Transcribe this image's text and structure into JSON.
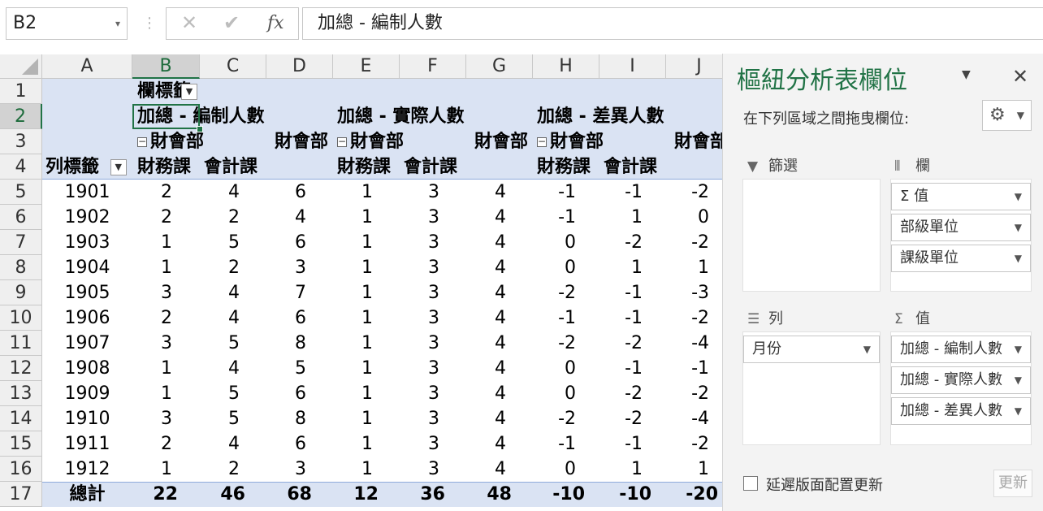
{
  "formula_bar": {
    "name_box": "B2",
    "cancel_icon": "✕",
    "enter_icon": "✔",
    "fx_label": "fx",
    "content": "加總 - 編制人數"
  },
  "columns": [
    "A",
    "B",
    "C",
    "D",
    "E",
    "F",
    "G",
    "H",
    "I",
    "J"
  ],
  "rows": [
    "1",
    "2",
    "3",
    "4",
    "5",
    "6",
    "7",
    "8",
    "9",
    "10",
    "11",
    "12",
    "13",
    "14",
    "15",
    "16",
    "17"
  ],
  "pivot": {
    "col_labels": "欄標籤",
    "row_labels": "列標籤",
    "value_headers": [
      "加總 - 編制人數",
      "加總 - 實際人數",
      "加總 - 差異人數"
    ],
    "dept": "財會部",
    "sections": [
      "財務課",
      "會計課"
    ],
    "dept_total": "財會部",
    "data": [
      [
        "1901",
        "2",
        "4",
        "6",
        "1",
        "3",
        "4",
        "-1",
        "-1",
        "-2"
      ],
      [
        "1902",
        "2",
        "2",
        "4",
        "1",
        "3",
        "4",
        "-1",
        "1",
        "0"
      ],
      [
        "1903",
        "1",
        "5",
        "6",
        "1",
        "3",
        "4",
        "0",
        "-2",
        "-2"
      ],
      [
        "1904",
        "1",
        "2",
        "3",
        "1",
        "3",
        "4",
        "0",
        "1",
        "1"
      ],
      [
        "1905",
        "3",
        "4",
        "7",
        "1",
        "3",
        "4",
        "-2",
        "-1",
        "-3"
      ],
      [
        "1906",
        "2",
        "4",
        "6",
        "1",
        "3",
        "4",
        "-1",
        "-1",
        "-2"
      ],
      [
        "1907",
        "3",
        "5",
        "8",
        "1",
        "3",
        "4",
        "-2",
        "-2",
        "-4"
      ],
      [
        "1908",
        "1",
        "4",
        "5",
        "1",
        "3",
        "4",
        "0",
        "-1",
        "-1"
      ],
      [
        "1909",
        "1",
        "5",
        "6",
        "1",
        "3",
        "4",
        "0",
        "-2",
        "-2"
      ],
      [
        "1910",
        "3",
        "5",
        "8",
        "1",
        "3",
        "4",
        "-2",
        "-2",
        "-4"
      ],
      [
        "1911",
        "2",
        "4",
        "6",
        "1",
        "3",
        "4",
        "-1",
        "-1",
        "-2"
      ],
      [
        "1912",
        "1",
        "2",
        "3",
        "1",
        "3",
        "4",
        "0",
        "1",
        "1"
      ]
    ],
    "total": [
      "總計",
      "22",
      "46",
      "68",
      "12",
      "36",
      "48",
      "-10",
      "-10",
      "-20"
    ]
  },
  "pane": {
    "title": "樞紐分析表欄位",
    "subtitle": "在下列區域之間拖曳欄位:",
    "filters_label": "篩選",
    "columns_label": "欄",
    "rows_label": "列",
    "values_label": "值",
    "column_fields": [
      "Σ 值",
      "部級單位",
      "課級單位"
    ],
    "row_fields": [
      "月份"
    ],
    "value_fields": [
      "加總 - 編制人數",
      "加總 - 實際人數",
      "加總 - 差異人數"
    ],
    "defer_label": "延遲版面配置更新",
    "update_label": "更新"
  }
}
